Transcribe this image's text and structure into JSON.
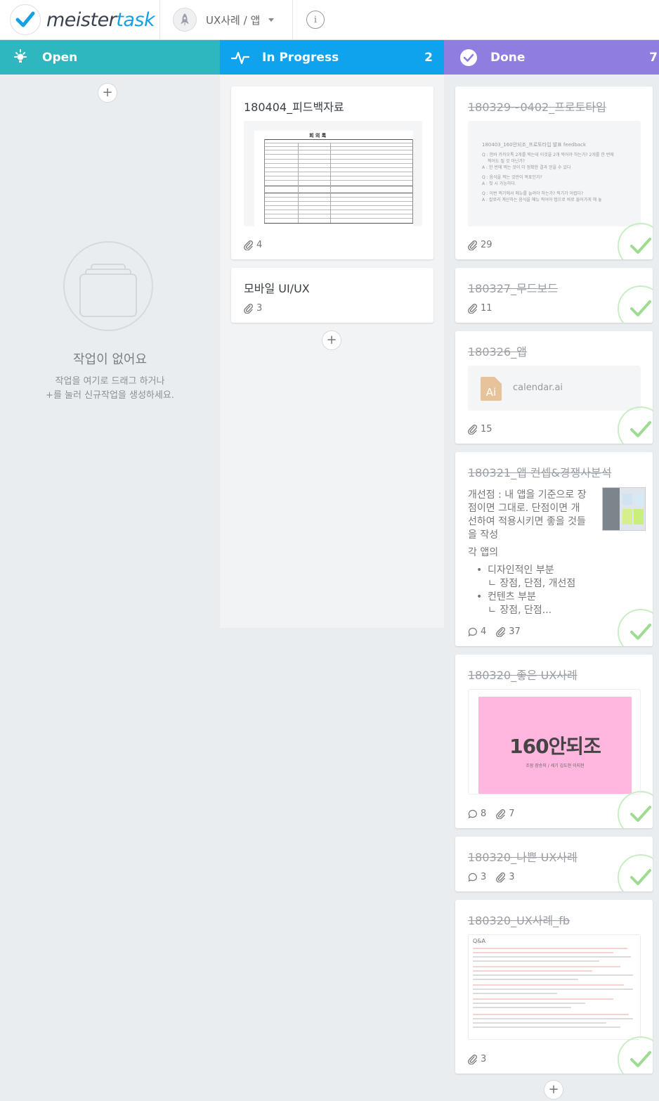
{
  "app": {
    "logo_part1": "meister",
    "logo_part2": "task",
    "project_name": "UX사례 / 앱",
    "info_label": "i"
  },
  "colors": {
    "open": "#2fb7bf",
    "in_progress": "#0fa3ee",
    "done": "#8f7ee0",
    "check": "#9fdc92"
  },
  "columns": {
    "open": {
      "title": "Open",
      "icon": "lightbulb-icon"
    },
    "in_progress": {
      "title": "In Progress",
      "count": "2",
      "icon": "activity-icon"
    },
    "done": {
      "title": "Done",
      "count": "7",
      "icon": "check-circle-icon"
    }
  },
  "empty_state": {
    "title": "작업이 없어요",
    "line1": "작업을 여기로 드래그 하거나",
    "line2": "+를 눌러 신규작업을 생성하세요."
  },
  "add_label": "+",
  "in_progress_tasks": [
    {
      "title": "180404_피드백자료",
      "attachments": "4",
      "preview_heading": "회 의 록"
    },
    {
      "title": "모바일 UI/UX",
      "attachments": "3"
    }
  ],
  "done_tasks": [
    {
      "title": "180329~0402_프로토타입",
      "attachments": "29",
      "preview_lines": [
        "180403_160안되조_프로토타입 발표 feedback",
        "Q : 한바 카카오톡 2개를 찍는데 이것을 2개 찍어야 하는가? 2개를 한 번에",
        "찍어도 될 것 아닌가?",
        "A : 한 번에 찍는 것이 더 정확한 결과 얻을 수 있다",
        "Q : 음식을 찍는 것만이 목표인가?",
        "A : 첫 시 가능하다.",
        "Q : 이번 찍기에서 메뉴를 늘려야 하는가? 찍기가 어렵다?",
        "A : 칼로리 계산하는 음식을 메뉴 찍어야 탭으로 바로 들어가게 해 놓"
      ]
    },
    {
      "title": "180327_무드보드",
      "attachments": "11"
    },
    {
      "title": "180326_앱",
      "attachments": "15",
      "file_name": "calendar.ai",
      "file_icon": "Ai"
    },
    {
      "title": "180321_앱 컨셉&경쟁사분석",
      "comments": "4",
      "attachments": "37",
      "desc_p1": "개선점 : 내 앱을 기준으로 장점이면 그대로. 단점이면 개선하여 적용시키면 좋을 것들을 작성",
      "desc_p2": "각 앱의",
      "desc_item1a": "디자인적인 부분",
      "desc_item1b": "ㄴ 장점, 단점, 개선점",
      "desc_item2a": "컨텐츠 부분",
      "desc_item2b": "ㄴ 장점, 단점..."
    },
    {
      "title": "180320_좋은 UX사례",
      "comments": "8",
      "attachments": "7",
      "slide_title": "160안되조",
      "slide_sub": "조장 장승미 / 세기 김도현 이지현"
    },
    {
      "title": "180320_나쁜 UX사례",
      "comments": "3",
      "attachments": "3"
    },
    {
      "title": "180320_UX사례_fb",
      "attachments": "3",
      "preview_heading": "Q&A"
    }
  ]
}
